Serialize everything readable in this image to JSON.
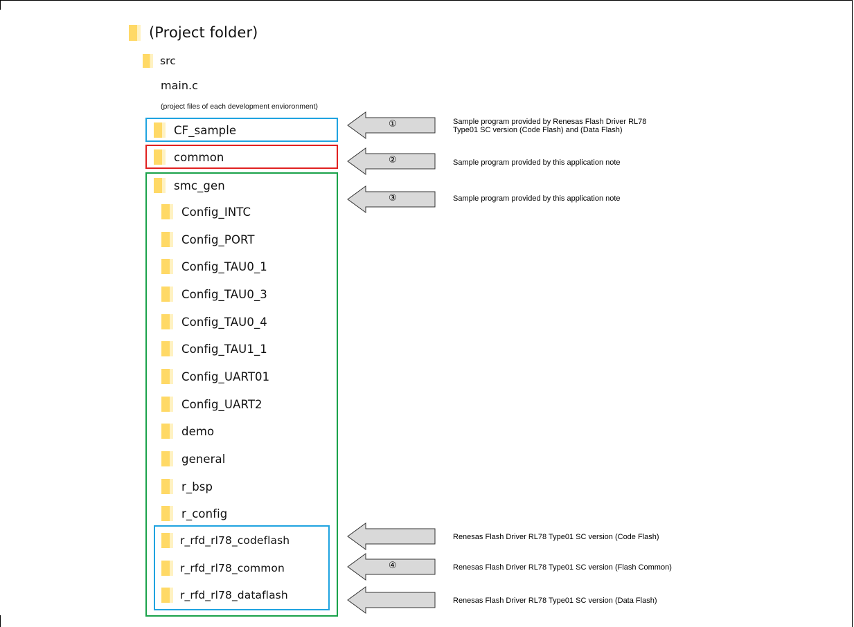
{
  "colors": {
    "folder_fill": "#FFD966",
    "folder_light": "#FFF2C2",
    "box_blue": "#1FA3E0",
    "box_red": "#E0201F",
    "box_green": "#1AA24A",
    "arrow_fill": "#D9D9D9",
    "arrow_stroke": "#333333"
  },
  "tree": {
    "root": "(Project folder)",
    "src": "src",
    "main": "main.c",
    "project_files": "(project files of each development envioronment)",
    "cf_sample": "CF_sample",
    "common": "common",
    "smc_gen": "smc_gen",
    "smc_children": [
      "Config_INTC",
      "Config_PORT",
      "Config_TAU0_1",
      "Config_TAU0_3",
      "Config_TAU0_4",
      "Config_TAU1_1",
      "Config_UART01",
      "Config_UART2",
      "demo",
      "general",
      "r_bsp",
      "r_config",
      "r_rfd_rl78_codeflash",
      "r_rfd_rl78_common",
      "r_rfd_rl78_dataflash"
    ]
  },
  "annotations": {
    "n1": "①",
    "n2": "②",
    "n3": "③",
    "n4": "④",
    "note1_line1": "Sample program provided by Renesas Flash Driver RL78",
    "note1_line2": "Type01 SC version (Code Flash) and (Data Flash)",
    "note2": "Sample program provided by this application note",
    "note3": "Sample program provided by this application note",
    "note4a": "Renesas Flash Driver RL78 Type01 SC version (Code Flash)",
    "note4b": "Renesas Flash Driver RL78 Type01 SC version (Flash Common)",
    "note4c": "Renesas Flash Driver RL78 Type01 SC version (Data Flash)"
  }
}
